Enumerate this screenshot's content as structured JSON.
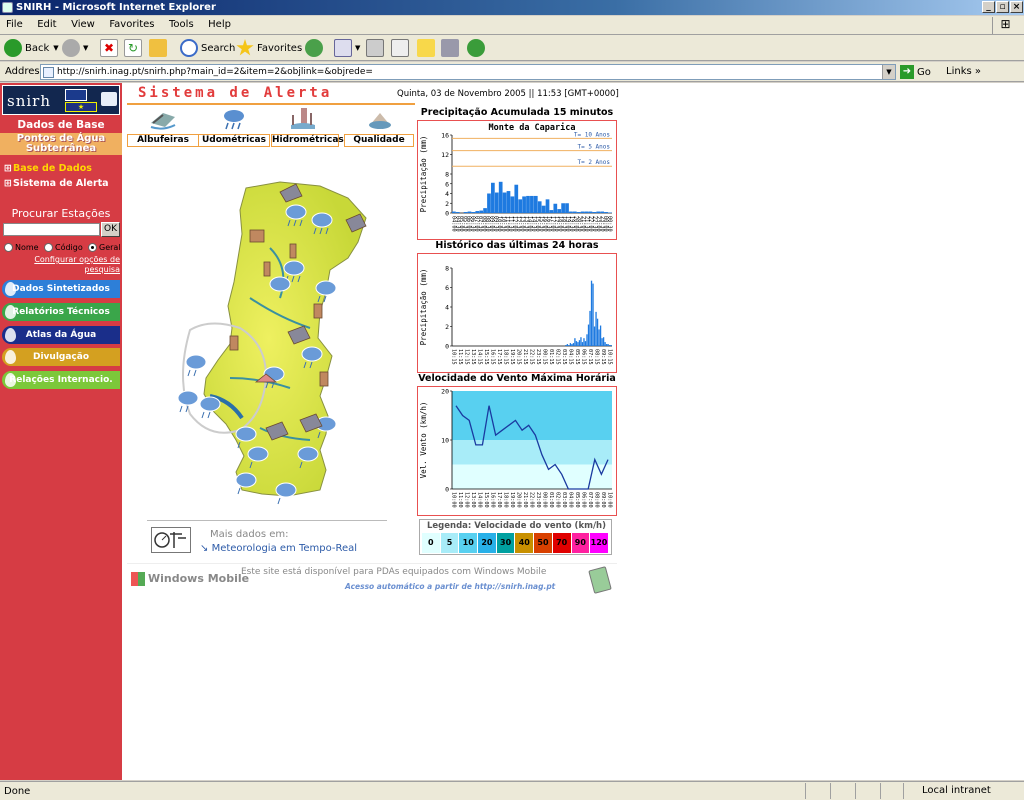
{
  "window": {
    "title": "SNIRH - Microsoft Internet Explorer"
  },
  "menu": [
    "File",
    "Edit",
    "View",
    "Favorites",
    "Tools",
    "Help"
  ],
  "toolbar": {
    "back": "Back",
    "search": "Search",
    "favorites": "Favorites"
  },
  "address": {
    "label": "Address",
    "url": "http://snirh.inag.pt/snirh.php?main_id=2&item=2&objlink=&objrede=",
    "go": "Go",
    "links": "Links"
  },
  "status": {
    "text": "Done",
    "zone": "Local intranet"
  },
  "sidebar": {
    "logo": "snirh",
    "dados_de_base": "Dados de Base",
    "pontos": "Pontos de Água Subterrânea",
    "base_de_dados": "Base de Dados",
    "sistema_de_alerta": "Sistema de Alerta",
    "procurar": "Procurar Estações",
    "ok": "OK",
    "radio": {
      "nome": "Nome",
      "codigo": "Código",
      "geral": "Geral"
    },
    "configurar": "Configurar opções de pesquisa",
    "pills": [
      {
        "label": "Dados Sintetizados",
        "color": "#2d7fd8"
      },
      {
        "label": "Relatórios Técnicos",
        "color": "#3aa64a"
      },
      {
        "label": "Atlas da Água",
        "color": "#1a2e8a"
      },
      {
        "label": "Divulgação",
        "color": "#d4a020"
      },
      {
        "label": "Relações Internacio.",
        "color": "#7cc83a"
      }
    ]
  },
  "main": {
    "title": "Sistema de Alerta",
    "datetime": "Quinta, 03 de Novembro 2005 || 11:53 [GMT+0000]",
    "categories": [
      "Albufeiras",
      "Udométricas",
      "Hidrométricas",
      "Qualidade"
    ],
    "mais_dados": "Mais dados em:",
    "meteo_link": "Meteorologia em Tempo-Real",
    "windows_mobile": "Windows Mobile",
    "wm_msg": "Este site está disponível para PDAs equipados com Windows Mobile",
    "wm_access": "Acesso automático a partir de http://snirh.inag.pt"
  },
  "charts": {
    "c1_title": "Precipitação Acumulada 15 minutos",
    "c1_station": "Monte da Caparica",
    "c2_title": "Histórico das últimas 24 horas",
    "c3_title": "Velocidade do Vento Máxima Horária",
    "legend_title": "Legenda: Velocidade do vento (km/h)",
    "legend": [
      {
        "v": "0",
        "c": "#e0ffff"
      },
      {
        "v": "5",
        "c": "#a8ecf8"
      },
      {
        "v": "10",
        "c": "#58d0f0"
      },
      {
        "v": "20",
        "c": "#28b0e8"
      },
      {
        "v": "30",
        "c": "#00a0a0"
      },
      {
        "v": "40",
        "c": "#c89000"
      },
      {
        "v": "50",
        "c": "#d84000"
      },
      {
        "v": "70",
        "c": "#e00000"
      },
      {
        "v": "90",
        "c": "#ff20a0"
      },
      {
        "v": "120",
        "c": "#ff00ff"
      }
    ]
  },
  "chart_data": [
    {
      "type": "bar",
      "title": "Precipitação Acumulada 15 minutos",
      "subtitle": "Monte da Caparica",
      "ylabel": "Precipitação (mm)",
      "ylim": [
        0,
        16
      ],
      "yticks": [
        0,
        2,
        4,
        6,
        8,
        12,
        16
      ],
      "thresholds": [
        {
          "label": "T= 10 Anos",
          "value": 15.3
        },
        {
          "label": "T= 5 Anos",
          "value": 12.8
        },
        {
          "label": "T= 2 Anos",
          "value": 9.6
        }
      ],
      "categories": [
        "04:00",
        "04:15",
        "04:30",
        "04:45",
        "05:00",
        "05:15",
        "05:30",
        "05:45",
        "06:00",
        "06:15",
        "06:30",
        "06:45",
        "07:00",
        "07:15",
        "07:30",
        "07:45",
        "08:00",
        "08:15",
        "08:30",
        "08:45",
        "09:00",
        "09:15",
        "09:30",
        "09:45",
        "10:00",
        "10:15",
        "10:30",
        "10:45",
        "11:00",
        "11:15",
        "11:30",
        "11:45",
        "12:00",
        "12:15",
        "12:30",
        "12:45",
        "13:00",
        "13:15",
        "13:30",
        "13:45",
        "14:00"
      ],
      "x_ticks": [
        "04:00",
        "04:30",
        "05:00",
        "05:30",
        "06:00",
        "06:30",
        "07:00",
        "07:30",
        "08:00",
        "08:30",
        "09:00",
        "09:30",
        "10:00",
        "10:30",
        "11:00",
        "11:30",
        "12:00",
        "12:30",
        "13:00",
        "13:30",
        "14:00",
        "14:30",
        "15:00",
        "15:30",
        "16:00",
        "16:30",
        "17:00",
        "17:30",
        "18:00",
        "18:30",
        "19:00",
        "19:30",
        "20:00",
        "20:30",
        "21:00",
        "21:30",
        "22:00",
        "22:30",
        "23:00",
        "23:30",
        "00:00",
        "00:30"
      ],
      "values": [
        0.3,
        0.2,
        0,
        0.2,
        0.3,
        0.2,
        0.4,
        0.5,
        1.0,
        4.0,
        6.2,
        4.2,
        6.4,
        4.2,
        4.5,
        3.4,
        5.8,
        2.8,
        3.4,
        3.5,
        3.5,
        3.5,
        2.4,
        1.5,
        2.8,
        0.6,
        1.9,
        0.8,
        2.0,
        2.0,
        0.3,
        0.3,
        0.2,
        0.3,
        0.3,
        0.3,
        0.2,
        0.3,
        0.3,
        0.2,
        0.1
      ]
    },
    {
      "type": "bar",
      "title": "Histórico das últimas 24 horas",
      "ylabel": "Precipitação (mm)",
      "ylim": [
        0,
        8
      ],
      "yticks": [
        0,
        2,
        4,
        6,
        8
      ],
      "x_ticks": [
        "10:15",
        "11:15",
        "12:15",
        "13:15",
        "14:15",
        "15:15",
        "16:15",
        "17:15",
        "18:15",
        "19:15",
        "20:15",
        "21:15",
        "22:15",
        "23:15",
        "00:15",
        "01:15",
        "02:15",
        "03:15",
        "04:15",
        "05:15",
        "06:15",
        "07:15",
        "08:15",
        "09:15",
        "10:15"
      ],
      "values": [
        0,
        0,
        0,
        0,
        0,
        0,
        0,
        0,
        0,
        0,
        0,
        0,
        0,
        0,
        0,
        0,
        0,
        0,
        0,
        0,
        0,
        0,
        0,
        0,
        0,
        0,
        0,
        0,
        0,
        0,
        0,
        0,
        0,
        0,
        0,
        0,
        0,
        0,
        0,
        0,
        0,
        0,
        0,
        0,
        0,
        0,
        0,
        0,
        0,
        0,
        0,
        0,
        0,
        0,
        0,
        0,
        0,
        0,
        0,
        0,
        0,
        0,
        0,
        0,
        0,
        0,
        0,
        0,
        0,
        0,
        0,
        0,
        0,
        0,
        0,
        0.1,
        0.2,
        0.1,
        0.3,
        0.2,
        0.3,
        0.8,
        0.5,
        0.4,
        0.6,
        0.9,
        0.4,
        0.8,
        0.5,
        1.2,
        2.2,
        3.6,
        6.7,
        6.4,
        2.0,
        3.5,
        2.8,
        1.7,
        2.1,
        0.8,
        0.9,
        0.4,
        0.2,
        0.2,
        0.1,
        0.1
      ]
    },
    {
      "type": "line",
      "title": "Velocidade do Vento Máxima Horária",
      "ylabel": "Vel. Vento (km/h)",
      "ylim": [
        0,
        20
      ],
      "yticks": [
        0,
        10,
        20
      ],
      "x_ticks": [
        "10:00",
        "11:00",
        "12:00",
        "13:00",
        "14:00",
        "15:00",
        "16:00",
        "17:00",
        "18:00",
        "19:00",
        "20:00",
        "21:00",
        "22:00",
        "23:00",
        "00:00",
        "01:00",
        "02:00",
        "03:00",
        "04:00",
        "05:00",
        "06:00",
        "07:00",
        "08:00",
        "09:00",
        "10:00"
      ],
      "values": [
        17,
        15,
        14,
        9,
        9,
        17,
        11,
        12,
        13,
        14,
        12,
        13,
        11,
        7,
        4,
        5,
        3,
        0,
        0,
        0,
        0,
        6,
        3,
        6
      ],
      "bands": [
        {
          "from": 0,
          "to": 5,
          "color": "#e0ffff"
        },
        {
          "from": 5,
          "to": 10,
          "color": "#a8ecf8"
        },
        {
          "from": 10,
          "to": 20,
          "color": "#58d0f0"
        }
      ]
    }
  ]
}
